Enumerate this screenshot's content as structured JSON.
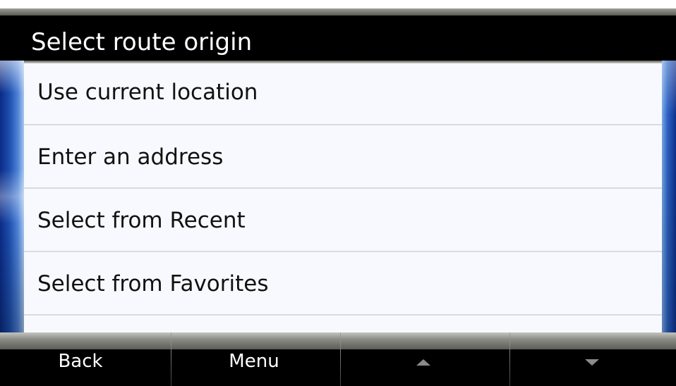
{
  "title": "Select route origin",
  "menu": {
    "items": [
      {
        "label": "Use current location"
      },
      {
        "label": "Enter an address"
      },
      {
        "label": "Select from Recent"
      },
      {
        "label": "Select from Favorites"
      }
    ]
  },
  "softkeys": {
    "back_label": "Back",
    "menu_label": "Menu",
    "up_icon": "scroll-up-arrow",
    "down_icon": "scroll-down-arrow"
  },
  "colors": {
    "title_bar": "#000000",
    "list_background": "#f7f9fe",
    "accent_blue": "#1d4fb0",
    "softkey_bar": "#000000"
  }
}
